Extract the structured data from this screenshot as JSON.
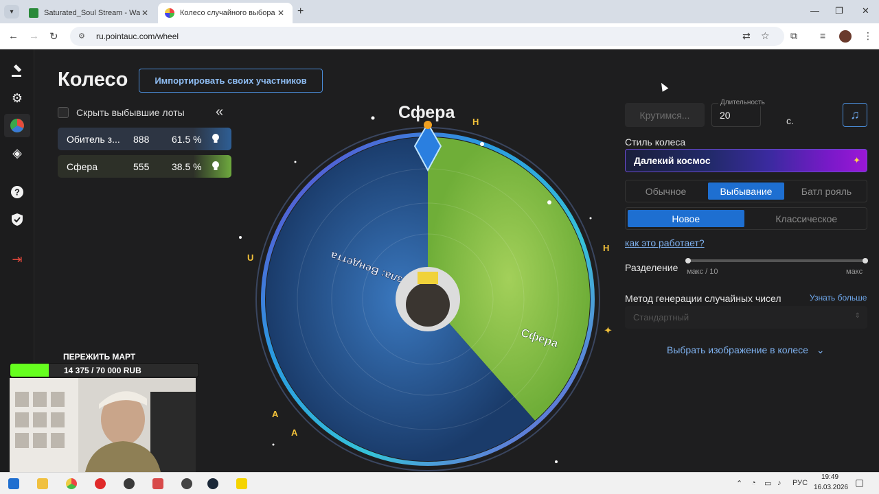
{
  "browser": {
    "tabs": [
      {
        "title": "Saturated_Soul Stream - Watch",
        "active": false
      },
      {
        "title": "Колесо случайного выбора – Р",
        "active": true
      }
    ],
    "url": "ru.pointauc.com/wheel"
  },
  "page": {
    "title": "Колесо",
    "import_button": "Импортировать своих участников",
    "hide_eliminated": "Скрыть выбывшие лоты",
    "lots": [
      {
        "name": "Обитель з...",
        "amount": "888",
        "percent": "61.5 %",
        "color": "#2e6fbf"
      },
      {
        "name": "Сфера",
        "amount": "555",
        "percent": "38.5 %",
        "color": "#7fbf3f"
      }
    ]
  },
  "wheel": {
    "winner_label": "Сфера",
    "segments": [
      {
        "label": "Обитель зла: Вендетта",
        "share": 0.615,
        "color": "#2c64a6"
      },
      {
        "label": "Сфера",
        "share": 0.385,
        "color": "#86c043"
      }
    ]
  },
  "controls": {
    "spin_button": "Крутимся...",
    "duration_label": "Длительность",
    "duration_value": "20",
    "duration_unit": "с.",
    "wheel_style_label": "Стиль колеса",
    "wheel_style_value": "Далекий космос",
    "mode_options": [
      "Обычное",
      "Выбывание",
      "Батл рояль"
    ],
    "mode_selected": "Выбывание",
    "variant_options": [
      "Новое",
      "Классическое"
    ],
    "variant_selected": "Новое",
    "how_link": "как это работает?",
    "split_label": "Разделение",
    "split_min": "макс / 10",
    "split_max": "макс",
    "rng_label": "Метод генерации случайных чисел",
    "rng_link": "Узнать больше",
    "rng_value": "Стандартный",
    "choose_image": "Выбрать изображение в колесе"
  },
  "overlay": {
    "goal_title": "ПЕРЕЖИТЬ МАРТ",
    "goal_text": "14 375 / 70 000 RUB",
    "goal_progress": 0.2054
  },
  "taskbar": {
    "lang": "РУС",
    "time": "19:49",
    "date": "16.03.2026"
  }
}
